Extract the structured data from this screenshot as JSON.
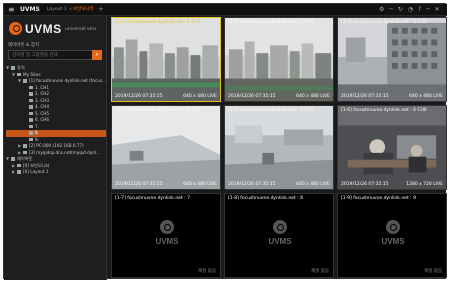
{
  "app": {
    "menu_icon": "hamburger-menu-icon",
    "brand": "UVMS",
    "tabs": [
      {
        "label": "Layout 1",
        "active": false
      },
      {
        "label": "보안모니터",
        "active": true
      }
    ],
    "add_tab": "+",
    "top_icons": "⚙ ─ ↻ ◔ ? ─ ✕"
  },
  "sidebar": {
    "logo_text": "UVMS",
    "logo_sub": "universal vms",
    "subtitle": "레이아웃 & 장치",
    "search_placeholder": "장치명 및 그룹명을 검색",
    "search_icon": "search-icon",
    "tree": [
      {
        "indent": 0,
        "arrow": "▼",
        "label": "장치",
        "selected": false
      },
      {
        "indent": 1,
        "arrow": "▼",
        "label": "My Sites",
        "selected": false
      },
      {
        "indent": 2,
        "arrow": "▼",
        "label": "[1] focushnuvne dynlink.net (focus...",
        "selected": false
      },
      {
        "indent": 3,
        "arrow": "",
        "label": "1. CH1",
        "selected": false
      },
      {
        "indent": 3,
        "arrow": "",
        "label": "2. CH2",
        "selected": false
      },
      {
        "indent": 3,
        "arrow": "",
        "label": "3. CH3",
        "selected": false
      },
      {
        "indent": 3,
        "arrow": "",
        "label": "4. CH4",
        "selected": false
      },
      {
        "indent": 3,
        "arrow": "",
        "label": "5. CH5",
        "selected": false
      },
      {
        "indent": 3,
        "arrow": "",
        "label": "6. CH6",
        "selected": false
      },
      {
        "indent": 3,
        "arrow": "",
        "label": "7.",
        "selected": false
      },
      {
        "indent": 3,
        "arrow": "",
        "label": "8.",
        "selected": true
      },
      {
        "indent": 3,
        "arrow": "",
        "label": "9.",
        "selected": false
      },
      {
        "indent": 2,
        "arrow": "▶",
        "label": "[2] PC-000 (192.168.0.77)",
        "selected": false
      },
      {
        "indent": 2,
        "arrow": "▶",
        "label": "[3] myipdsp.dns.net(myipd.dynl...",
        "selected": false
      },
      {
        "indent": 0,
        "arrow": "▼",
        "label": "레이아웃",
        "selected": false
      },
      {
        "indent": 1,
        "arrow": "▶",
        "label": "[0] 보안모니터",
        "selected": false
      },
      {
        "indent": 1,
        "arrow": "▶",
        "label": "[0] Layout 1",
        "selected": false
      }
    ]
  },
  "cells": [
    {
      "title": "[1-1] focushnuvne.dynlink.net : 1 CH1",
      "timestamp": "2019/12/26 07:35:15",
      "res": "640 x 480  LIVE",
      "feed": "skyline",
      "active": true
    },
    {
      "title": "[1-2] focushnuvne.dynlink.net : 2 CH2",
      "timestamp": "2019/12/26 07:35:15",
      "res": "640 x 480  LIVE",
      "feed": "skyline2",
      "active": false
    },
    {
      "title": "[1-3] focushnuvne.dynlink.net : 3 CH3",
      "timestamp": "2019/12/26 07:35:15",
      "res": "640 x 480  LIVE",
      "feed": "building",
      "active": false
    },
    {
      "title": "[1-4] focushnuvne.dynlink.net : 4 CH4",
      "timestamp": "2019/12/26 07:35:15",
      "res": "640 x 480  LIVE",
      "feed": "roof",
      "active": false
    },
    {
      "title": "[1-5] focushnuvne.dynlink.net : 5 CH5",
      "timestamp": "2019/12/26 07:35:15",
      "res": "640 x 480  LIVE",
      "feed": "roof2",
      "active": false
    },
    {
      "title": "[1-6] focushnuvne.dynlink.net : 6 CH6",
      "timestamp": "2019/12/26 07:35:15",
      "res": "1280 x 720  LIVE",
      "feed": "office",
      "active": false
    },
    {
      "title": "[1-7] focushnuvne.dynlink.net : 7",
      "nosig": "재생 없음",
      "feed": "empty",
      "active": false
    },
    {
      "title": "[1-8] focushnuvne.dynlink.net : 8",
      "nosig": "재생 없음",
      "feed": "empty",
      "active": false
    },
    {
      "title": "[1-9] focushnuvne.dynlink.net : 9",
      "nosig": "재생 없음",
      "feed": "empty",
      "active": false
    }
  ],
  "empty_logo": "UVMS"
}
